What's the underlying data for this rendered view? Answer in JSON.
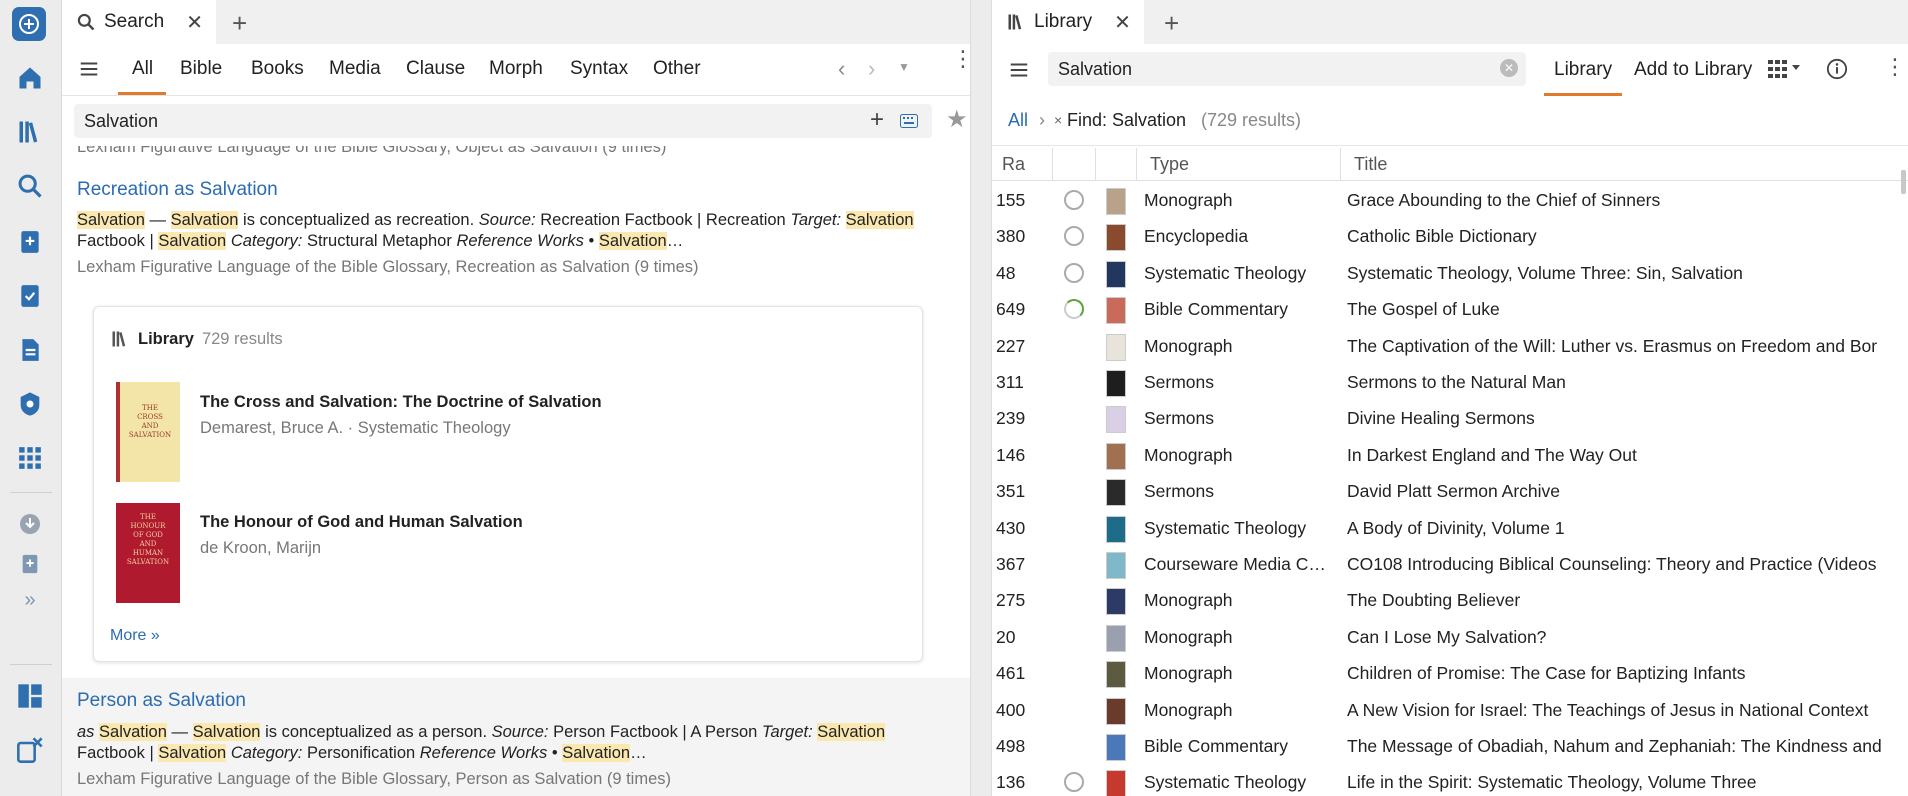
{
  "left_tab": {
    "label": "Search"
  },
  "search_nav": {
    "tabs": [
      "All",
      "Bible",
      "Books",
      "Media",
      "Clause",
      "Morph",
      "Syntax",
      "Other"
    ]
  },
  "search_query": "Salvation",
  "results": {
    "top_cut_text": "Lexham Figurative Language of the Bible Glossary, Object as Salvation (9 times)",
    "r1": {
      "title": "Recreation as Salvation",
      "meta": "Lexham Figurative Language of the Bible Glossary, Recreation as Salvation (9 times)"
    },
    "library_card": {
      "label": "Library",
      "count": "729 results",
      "books": [
        {
          "title": "The Cross and Salvation: The Doctrine of Salvation",
          "sub": "Demarest, Bruce A. · Systematic Theology"
        },
        {
          "title": "The Honour of God and Human Salvation",
          "sub": "de Kroon, Marijn"
        }
      ],
      "more": "More »"
    },
    "r2": {
      "title": "Person as Salvation",
      "meta": "Lexham Figurative Language of the Bible Glossary, Person as Salvation (9 times)"
    }
  },
  "right_tab": {
    "label": "Library"
  },
  "library_search": "Salvation",
  "library_toolbar": {
    "library": "Library",
    "add": "Add to Library"
  },
  "breadcrumb": {
    "all": "All",
    "find": "Find: Salvation",
    "count": "(729 results)"
  },
  "columns": {
    "rank": "Ra",
    "type": "Type",
    "title": "Title"
  },
  "rows": [
    {
      "rank": "155",
      "status": "open",
      "type": "Monograph",
      "title": "Grace Abounding to the Chief of Sinners",
      "thumb": "#b9a28a"
    },
    {
      "rank": "380",
      "status": "open",
      "type": "Encyclopedia",
      "title": "Catholic Bible Dictionary",
      "thumb": "#8a4a2e"
    },
    {
      "rank": "48",
      "status": "open",
      "type": "Systematic Theology",
      "title": "Systematic Theology, Volume Three: Sin, Salvation",
      "thumb": "#23365e"
    },
    {
      "rank": "649",
      "status": "progress",
      "type": "Bible Commentary",
      "title": "The Gospel of Luke",
      "thumb": "#c96a5a"
    },
    {
      "rank": "227",
      "status": "none",
      "type": "Monograph",
      "title": "The Captivation of the Will: Luther vs. Erasmus on Freedom and Bor",
      "thumb": "#e8e4dc"
    },
    {
      "rank": "311",
      "status": "none",
      "type": "Sermons",
      "title": "Sermons to the Natural Man",
      "thumb": "#1e1e1e"
    },
    {
      "rank": "239",
      "status": "none",
      "type": "Sermons",
      "title": "Divine Healing Sermons",
      "thumb": "#d9d0e6"
    },
    {
      "rank": "146",
      "status": "none",
      "type": "Monograph",
      "title": "In Darkest England and The Way Out",
      "thumb": "#a07050"
    },
    {
      "rank": "351",
      "status": "none",
      "type": "Sermons",
      "title": "David Platt Sermon Archive",
      "thumb": "#2a2a2a"
    },
    {
      "rank": "430",
      "status": "none",
      "type": "Systematic Theology",
      "title": "A Body of Divinity, Volume 1",
      "thumb": "#1d6d8a"
    },
    {
      "rank": "367",
      "status": "none",
      "type": "Courseware Media C…",
      "title": "CO108 Introducing Biblical Counseling: Theory and Practice (Videos",
      "thumb": "#7fb8c8"
    },
    {
      "rank": "275",
      "status": "none",
      "type": "Monograph",
      "title": "The Doubting Believer",
      "thumb": "#2c3a66"
    },
    {
      "rank": "20",
      "status": "none",
      "type": "Monograph",
      "title": "Can I Lose My Salvation?",
      "thumb": "#9aa0b0"
    },
    {
      "rank": "461",
      "status": "none",
      "type": "Monograph",
      "title": "Children of Promise: The Case for Baptizing Infants",
      "thumb": "#5c5a40"
    },
    {
      "rank": "400",
      "status": "none",
      "type": "Monograph",
      "title": "A New Vision for Israel: The Teachings of Jesus in National Context",
      "thumb": "#6a3a2a"
    },
    {
      "rank": "498",
      "status": "none",
      "type": "Bible Commentary",
      "title": "The Message of Obadiah, Nahum and Zephaniah: The Kindness and",
      "thumb": "#4a78b8"
    },
    {
      "rank": "136",
      "status": "open",
      "type": "Systematic Theology",
      "title": "Life in the Spirit: Systematic Theology, Volume Three",
      "thumb": "#c63a2e"
    }
  ],
  "colors": {
    "accent": "#e07b2e",
    "link": "#2b6cb0",
    "highlight": "#fbe8b0",
    "logo": "#2f6fb0"
  }
}
